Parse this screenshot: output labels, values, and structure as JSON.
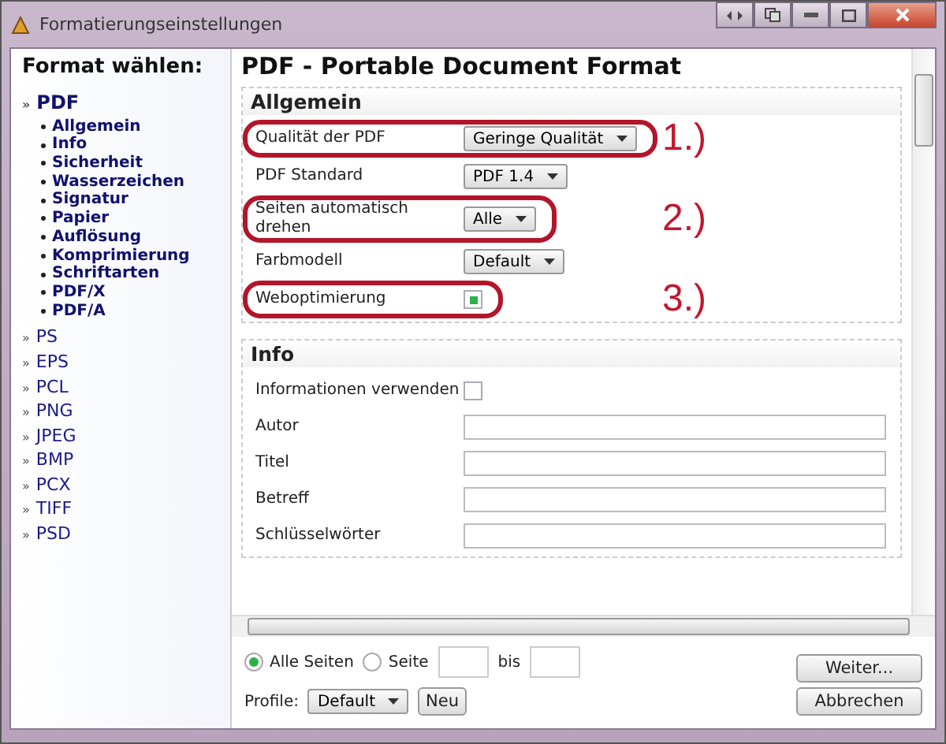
{
  "window": {
    "title": "Formatierungseinstellungen"
  },
  "sidebar": {
    "heading": "Format wählen:",
    "formats": [
      {
        "marker": "»",
        "label": "PDF",
        "selected": true,
        "children": [
          {
            "label": "Allgemein"
          },
          {
            "label": "Info"
          },
          {
            "label": "Sicherheit"
          },
          {
            "label": "Wasserzeichen"
          },
          {
            "label": "Signatur"
          },
          {
            "label": "Papier"
          },
          {
            "label": "Auflösung"
          },
          {
            "label": "Komprimierung"
          },
          {
            "label": "Schriftarten"
          },
          {
            "label": "PDF/X"
          },
          {
            "label": "PDF/A"
          }
        ]
      },
      {
        "marker": "»",
        "label": "PS",
        "selected": false
      },
      {
        "marker": "»",
        "label": "EPS",
        "selected": false
      },
      {
        "marker": "»",
        "label": "PCL",
        "selected": false
      },
      {
        "marker": "»",
        "label": "PNG",
        "selected": false
      },
      {
        "marker": "»",
        "label": "JPEG",
        "selected": false
      },
      {
        "marker": "»",
        "label": "BMP",
        "selected": false
      },
      {
        "marker": "»",
        "label": "PCX",
        "selected": false
      },
      {
        "marker": "»",
        "label": "TIFF",
        "selected": false
      },
      {
        "marker": "»",
        "label": "PSD",
        "selected": false
      }
    ]
  },
  "main": {
    "title": "PDF - Portable Document Format",
    "sections": [
      {
        "title": "Allgemein",
        "rows": [
          {
            "label": "Qualität der PDF",
            "kind": "dropdown",
            "value": "Geringe Qualität",
            "annotation": "1.)"
          },
          {
            "label": "PDF Standard",
            "kind": "dropdown",
            "value": "PDF 1.4"
          },
          {
            "label": "Seiten automatisch drehen",
            "kind": "dropdown",
            "value": "Alle",
            "annotation": "2.)"
          },
          {
            "label": "Farbmodell",
            "kind": "dropdown",
            "value": "Default"
          },
          {
            "label": "Weboptimierung",
            "kind": "checkbox",
            "checked": true,
            "annotation": "3.)"
          }
        ]
      },
      {
        "title": "Info",
        "rows": [
          {
            "label": "Informationen verwenden",
            "kind": "checkbox",
            "checked": false
          },
          {
            "label": "Autor",
            "kind": "text"
          },
          {
            "label": "Titel",
            "kind": "text"
          },
          {
            "label": "Betreff",
            "kind": "text"
          },
          {
            "label": "Schlüsselwörter",
            "kind": "text"
          }
        ]
      }
    ]
  },
  "footer": {
    "pages": [
      {
        "label": "Alle Seiten",
        "selected": true
      },
      {
        "label": "Seite",
        "selected": false
      }
    ],
    "to_label": "bis",
    "profile_label": "Profile:",
    "profile": "Default",
    "new_button": "Neu",
    "buttons": [
      "Weiter...",
      "Abbrechen"
    ]
  }
}
